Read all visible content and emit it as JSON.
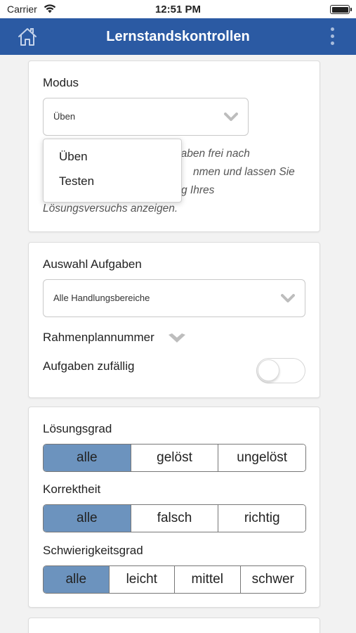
{
  "status": {
    "carrier": "Carrier",
    "time": "12:51 PM"
  },
  "nav": {
    "title": "Lernstandskontrollen",
    "home_icon": "home-icon",
    "more_icon": "more-vertical-icon"
  },
  "colors": {
    "nav_bg": "#2b5aa3",
    "segment_active": "#6c93be"
  },
  "modus": {
    "label": "Modus",
    "selected": "Üben",
    "description_lines": [
      "gaben frei nach",
      "nmen und lassen Sie",
      "g Ihres",
      "Lösungsversuchs anzeigen."
    ],
    "options": [
      "Üben",
      "Testen"
    ]
  },
  "auswahl": {
    "label": "Auswahl Aufgaben",
    "selected": "Alle Handlungsbereiche",
    "rahmen_label": "Rahmenplannummer",
    "random_label": "Aufgaben zufällig",
    "random_on": false
  },
  "filters": {
    "loesungsgrad": {
      "label": "Lösungsgrad",
      "options": [
        "alle",
        "gelöst",
        "ungelöst"
      ],
      "selected": "alle"
    },
    "korrektheit": {
      "label": "Korrektheit",
      "options": [
        "alle",
        "falsch",
        "richtig"
      ],
      "selected": "alle"
    },
    "schwierigkeit": {
      "label": "Schwierigkeitsgrad",
      "options": [
        "alle",
        "leicht",
        "mittel",
        "schwer"
      ],
      "selected": "alle"
    }
  }
}
